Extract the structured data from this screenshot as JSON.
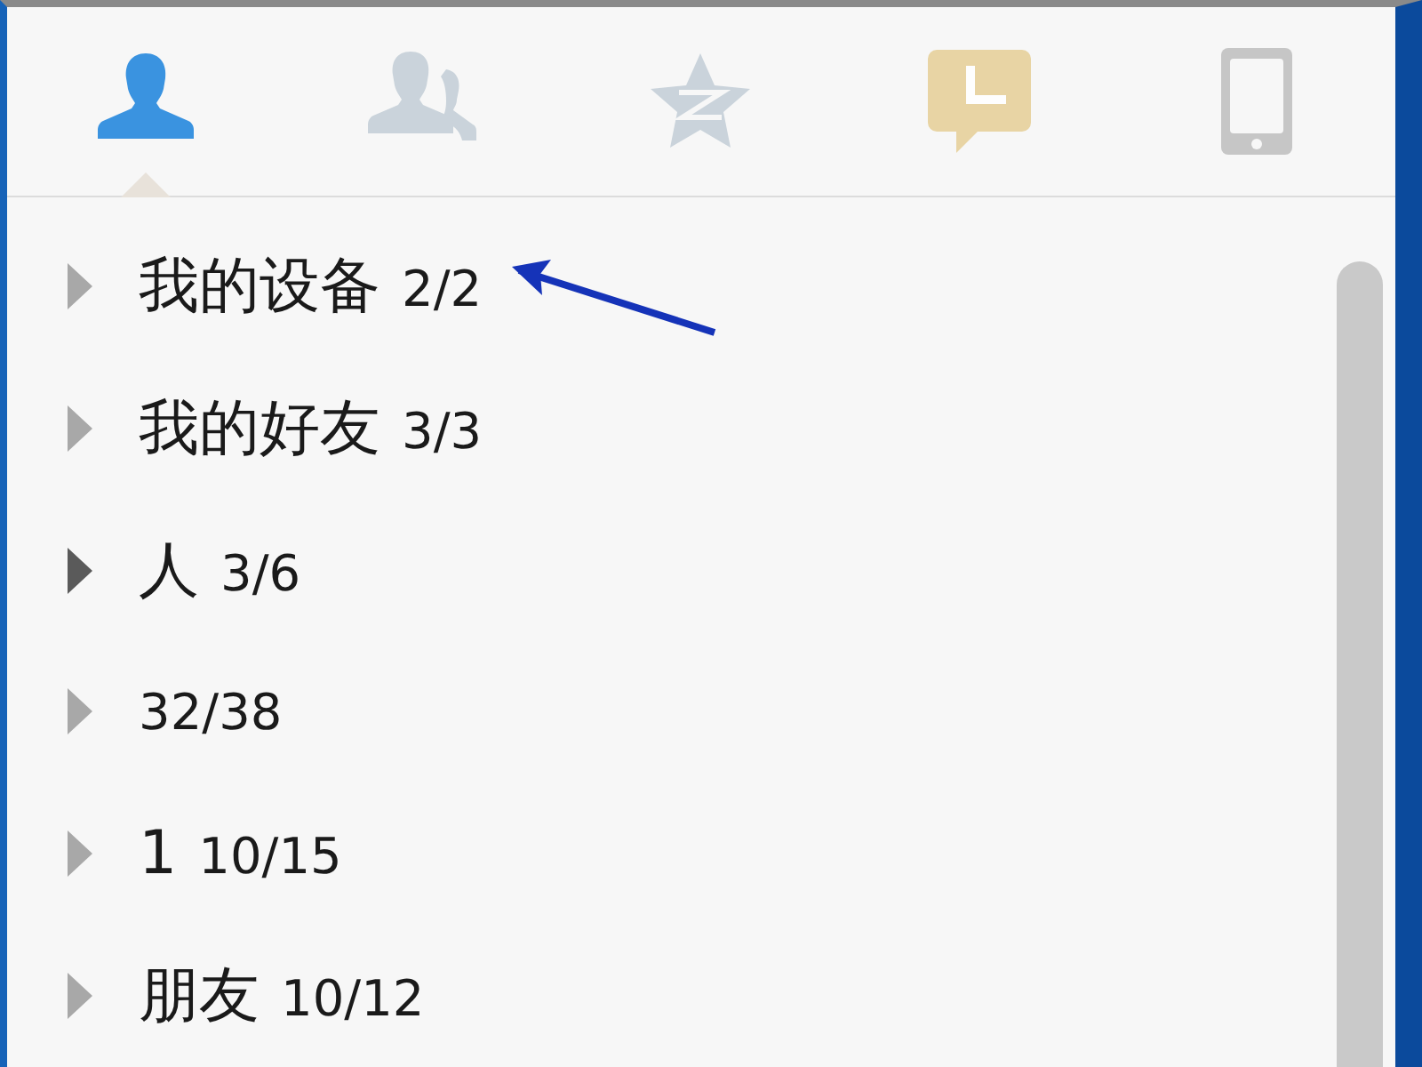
{
  "tabs": [
    {
      "kind": "contacts",
      "selected": true
    },
    {
      "kind": "groups",
      "selected": false
    },
    {
      "kind": "qzone",
      "selected": false
    },
    {
      "kind": "recent",
      "selected": false
    },
    {
      "kind": "phone",
      "selected": false
    }
  ],
  "groups": [
    {
      "name": "我的设备",
      "count": "2/2",
      "highlighted": false
    },
    {
      "name": "我的好友",
      "count": "3/3",
      "highlighted": false
    },
    {
      "name": "人",
      "count": "3/6",
      "highlighted": true
    },
    {
      "count": "32/38",
      "highlighted": false
    },
    {
      "name": "1",
      "count": "10/15",
      "highlighted": false
    },
    {
      "name": "朋友",
      "count": "10/12",
      "highlighted": false
    }
  ]
}
